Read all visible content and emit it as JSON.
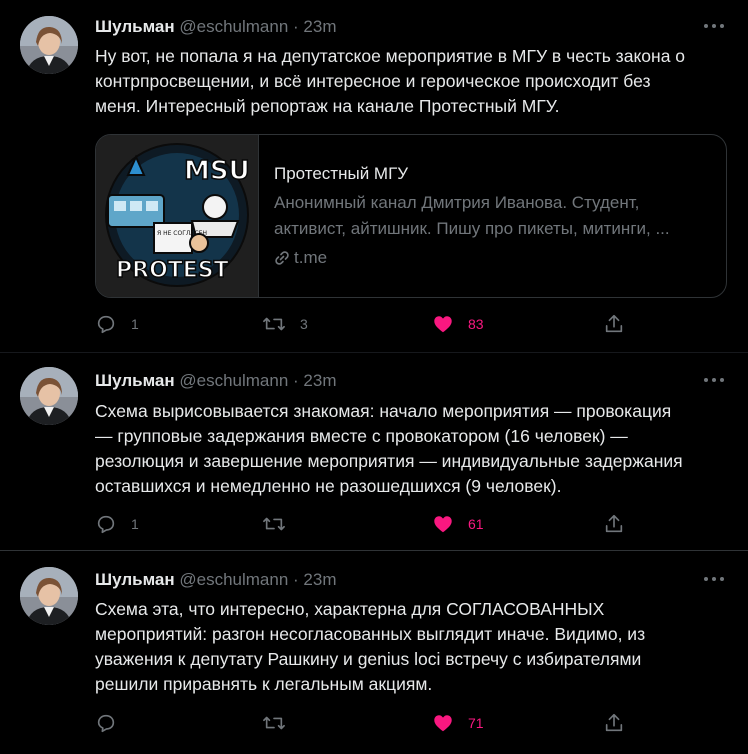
{
  "tweets": [
    {
      "name": "Шульман",
      "handle": "@eschulmann · 23m",
      "text_lines": [
        "Ну вот, не попала я на депутатское мероприятие в МГУ в честь закона о",
        "контрпросвещении, и всё интересное и героическое происходит без",
        "меня. Интересный репортаж на канале Протестный МГУ."
      ],
      "card": {
        "title": "Протестный МГУ",
        "desc_lines": [
          "Анонимный канал Дмитрия Иванова. Студент,",
          "активист, айтишник. Пишу про пикеты, митинги, ..."
        ],
        "link": "t.me",
        "image_text_top": "MSU",
        "image_text_bottom": "PROTEST",
        "image_sign": "Я НЕ СОГЛАСЕН"
      },
      "replies": "1",
      "retweets": "3",
      "likes": "83"
    },
    {
      "name": "Шульман",
      "handle": "@eschulmann · 23m",
      "text_lines": [
        "Схема вырисовывается знакомая: начало мероприятия — провокация",
        "— групповые задержания вместе с провокатором (16 человек) —",
        "резолюция и завершение мероприятия — индивидуальные задержания",
        "оставшихся и немедленно не разошедшихся (9 человек)."
      ],
      "replies": "1",
      "retweets": "",
      "likes": "61"
    },
    {
      "name": "Шульман",
      "handle": "@eschulmann · 23m",
      "text_lines": [
        "Схема эта, что интересно, характерна для СОГЛАСОВАННЫХ",
        "мероприятий: разгон несогласованных выглядит иначе. Видимо, из",
        "уважения к депутату Рашкину и genius loci встречу с избирателями",
        "решили приравнять к легальным акциям."
      ],
      "replies": "",
      "retweets": "",
      "likes": "71"
    }
  ],
  "colors": {
    "background": "#000000",
    "text": "#e7e9ea",
    "secondary": "#71767b",
    "like": "#f91880",
    "border": "#2f3336"
  },
  "icons": [
    "reply-icon",
    "retweet-icon",
    "like-icon",
    "share-icon",
    "more-icon",
    "link-icon"
  ]
}
